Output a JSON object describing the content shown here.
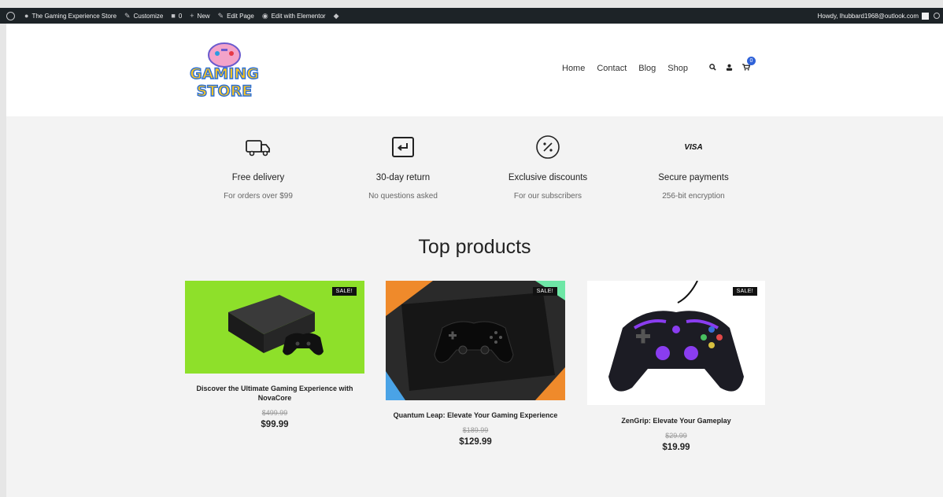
{
  "admin_bar": {
    "site_name": "The Gaming Experience Store",
    "customize": "Customize",
    "comments_count": "0",
    "new": "New",
    "edit_page": "Edit Page",
    "edit_elementor": "Edit with Elementor",
    "howdy": "Howdy, lhubbard1968@outlook.com"
  },
  "header": {
    "logo_text_line1": "GAMING",
    "logo_text_line2": "STORE",
    "nav": [
      "Home",
      "Contact",
      "Blog",
      "Shop"
    ],
    "cart_count": "0"
  },
  "features": [
    {
      "icon": "truck-icon",
      "title": "Free delivery",
      "subtitle": "For orders over $99"
    },
    {
      "icon": "return-icon",
      "title": "30-day return",
      "subtitle": "No questions asked"
    },
    {
      "icon": "percent-icon",
      "title": "Exclusive discounts",
      "subtitle": "For our subscribers"
    },
    {
      "icon": "visa-icon",
      "title": "Secure payments",
      "subtitle": "256-bit encryption",
      "icon_text": "VISA"
    }
  ],
  "section_title": "Top products",
  "products": [
    {
      "sale_badge": "SALE!",
      "title": "Discover the Ultimate Gaming Experience with NovaCore",
      "old_price": "$499.99",
      "new_price": "$99.99",
      "image_bg": "#8ee02a"
    },
    {
      "sale_badge": "SALE!",
      "title": "Quantum Leap: Elevate Your Gaming Experience",
      "old_price": "$189.99",
      "new_price": "$129.99",
      "image_bg": "#2a2a2a"
    },
    {
      "sale_badge": "SALE!",
      "title": "ZenGrip: Elevate Your Gameplay",
      "old_price": "$29.99",
      "new_price": "$19.99",
      "image_bg": "#ffffff"
    }
  ]
}
